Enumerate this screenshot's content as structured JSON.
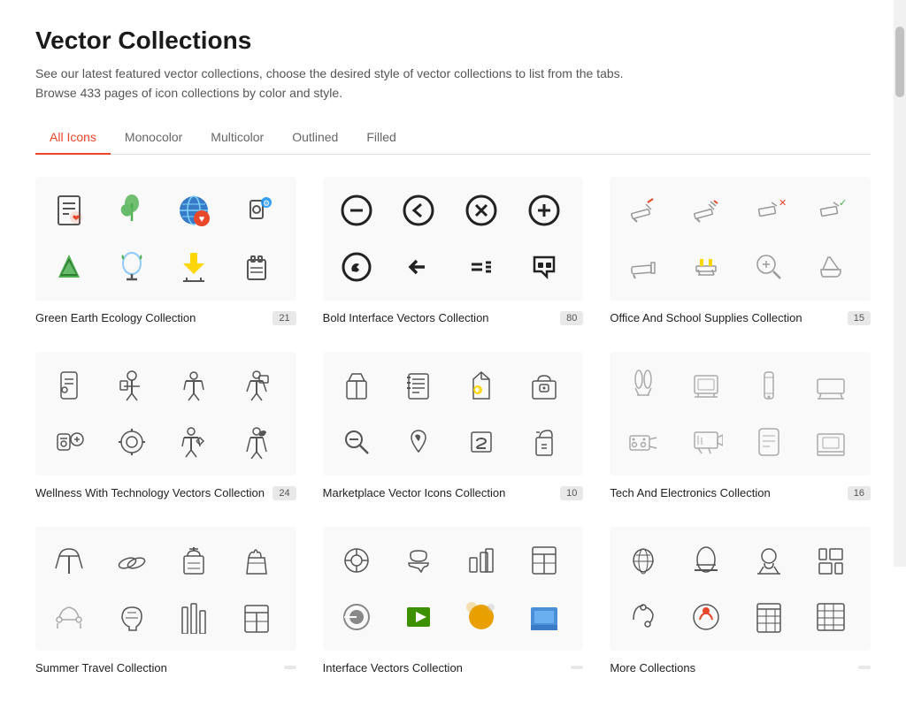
{
  "page": {
    "title": "Vector Collections",
    "subtitle_line1": "See our latest featured vector collections, choose the desired style of vector collections to list from the tabs.",
    "subtitle_line2": "Browse 433 pages of icon collections by color and style.",
    "from_text": "from"
  },
  "tabs": [
    {
      "label": "All Icons",
      "active": true
    },
    {
      "label": "Monocolor",
      "active": false
    },
    {
      "label": "Multicolor",
      "active": false
    },
    {
      "label": "Outlined",
      "active": false
    },
    {
      "label": "Filled",
      "active": false
    }
  ],
  "collections": [
    {
      "name": "Green Earth Ecology Collection",
      "count": "21",
      "icons": [
        "♻",
        "🌿",
        "🌐",
        "⚙",
        "🌲",
        "💨",
        "⚡",
        "🗑"
      ]
    },
    {
      "name": "Bold Interface Vectors Collection",
      "count": "80",
      "icons": [
        "⊖",
        "◀",
        "✕",
        "⊕",
        "⛹",
        "←",
        "〰",
        "◆"
      ]
    },
    {
      "name": "Office And School Supplies Collection",
      "count": "15",
      "icons": [
        "✏",
        "✏",
        "✏",
        "✏",
        "✏",
        "✏",
        "✂",
        "✏"
      ]
    },
    {
      "name": "Wellness With Technology Vectors Collection",
      "count": "24",
      "icons": [
        "📱",
        "👤",
        "🏃",
        "🏃",
        "⌚",
        "⚙",
        "🏃",
        "🏃"
      ]
    },
    {
      "name": "Marketplace Vector Icons Collection",
      "count": "10",
      "icons": [
        "👜",
        "📋",
        "🏠",
        "🏪",
        "🔍",
        "🔖",
        "👕",
        "🎁"
      ]
    },
    {
      "name": "Tech And Electronics Collection",
      "count": "16",
      "icons": [
        "🎧",
        "🖥",
        "⬜",
        "🖨",
        "🎮",
        "🚁",
        "📱",
        "🖥"
      ]
    },
    {
      "name": "Summer Travel Collection",
      "count": "",
      "icons": [
        "☂",
        "👡",
        "🎒",
        "👡",
        "🌊",
        "⚗",
        "📊",
        "📋"
      ]
    },
    {
      "name": "Interface Vectors Collection",
      "count": "",
      "icons": [
        "⚙",
        "⚗",
        "📊",
        "📋",
        "⏻",
        "🎥",
        "📷",
        "👥"
      ]
    },
    {
      "name": "More Collections",
      "count": "",
      "icons": [
        "⏻",
        "🎬",
        "📷",
        "👥",
        "⬜",
        "▦",
        "▦",
        "▦"
      ]
    }
  ]
}
